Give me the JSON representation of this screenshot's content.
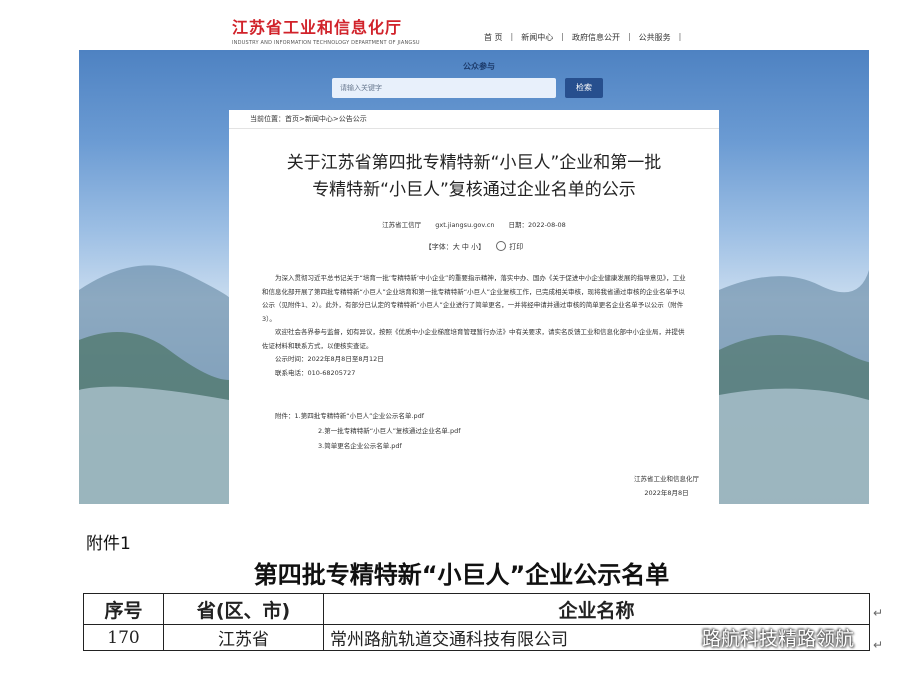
{
  "header": {
    "logo_cn": "江苏省工业和信息化厅",
    "logo_en": "INDUSTRY AND INFORMATION TECHNOLOGY DEPARTMENT OF JIANGSU",
    "nav": [
      "首 页",
      "新闻中心",
      "政府信息公开",
      "公共服务"
    ]
  },
  "banner": {
    "label": "公众参与",
    "search_placeholder": "请输入关键字",
    "search_button": "检索"
  },
  "article": {
    "breadcrumb": "当前位置：首页>新闻中心>公告公示",
    "title_line1": "关于江苏省第四批专精特新“小巨人”企业和第一批",
    "title_line2": "专精特新“小巨人”复核通过企业名单的公示",
    "source": "江苏省工信厅",
    "site": "gxt.jiangsu.gov.cn",
    "date": "日期：2022-08-08",
    "font_size_label": "【字体：大 中 小】",
    "print_label": "打印",
    "para1": "为深入贯彻习近平总书记关于“培育一批‘专精特新’中小企业”的重要指示精神，落实中办、国办《关于促进中小企业健康发展的指导意见》，工业和信息化部开展了第四批专精特新“小巨人”企业培育和第一批专精特新“小巨人”企业复核工作，已完成相关审核，现将我省通过审核的企业名单予以公示（见附件1、2）。此外，有部分已认定的专精特新“小巨人”企业进行了简单更名，一并将经申请并通过审核的简单更名企业名单予以公示（附件3）。",
    "para2": "欢迎社会各界参与监督，如有异议，按照《优质中小企业梯度培育管理暂行办法》中有关要求，请实名反馈工业和信息化部中小企业局，并提供佐证材料和联系方式，以便核实查证。",
    "period": "公示时间：2022年8月8日至8月12日",
    "phone": "联系电话：010-68205727",
    "attach_intro": "附件：1.第四批专精特新“小巨人”企业公示名单.pdf",
    "attach2": "2.第一批专精特新“小巨人”复核通过企业名单.pdf",
    "attach3": "3.简单更名企业公示名单.pdf",
    "sign_org": "江苏省工业和信息化厅",
    "sign_date": "2022年8月8日"
  },
  "attachment": {
    "label": "附件1",
    "title": "第四批专精特新“小巨人”企业公示名单",
    "columns": [
      "序号",
      "省(区、市)",
      "企业名称"
    ],
    "rows": [
      {
        "no": "170",
        "province": "江苏省",
        "company": "常州路航轨道交通科技有限公司"
      }
    ]
  },
  "watermark": "路航科技精路领航"
}
